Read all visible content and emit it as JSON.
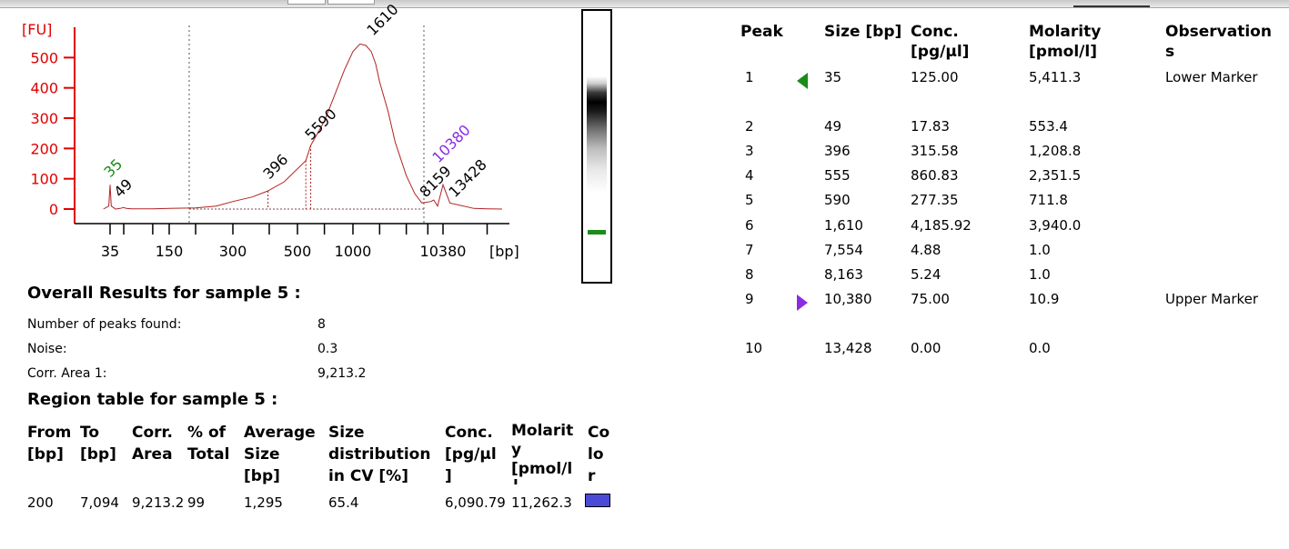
{
  "electropherogram": {
    "fu_label": "[FU]",
    "bp_label": "[bp]",
    "y_ticks": [
      "500",
      "400",
      "300",
      "200",
      "100",
      "0"
    ],
    "x_ticks": [
      "35",
      "150",
      "300",
      "500",
      "1000",
      "10380"
    ],
    "peak_labels": {
      "p35": "35",
      "p49": "49",
      "p396": "396",
      "p5590": "5590",
      "p1610": "1610",
      "p10380": "10380",
      "p13428": "13428",
      "p8159": "8159"
    },
    "colors": {
      "axis": "#e00000",
      "trace": "#b22222",
      "lower_marker": "#1a8c1a",
      "upper_marker": "#8a2be2",
      "grid_dotted": "#555555"
    }
  },
  "chart_data": {
    "type": "line",
    "title": "",
    "xlabel": "[bp]",
    "ylabel": "[FU]",
    "ylim": [
      0,
      550
    ],
    "x_scale": "log",
    "x_ticks": [
      35,
      150,
      300,
      500,
      1000,
      10380
    ],
    "series": [
      {
        "x": [
          30,
          34,
          35,
          36,
          40,
          45,
          49,
          52,
          60,
          100,
          150,
          200,
          250,
          300,
          350,
          396,
          450,
          555,
          590,
          700,
          800,
          900,
          1000,
          1200,
          1400,
          1610,
          1800,
          2000,
          2500,
          3000,
          4000,
          5000,
          6000,
          7554,
          8163,
          9000,
          10380,
          11000,
          13428,
          15000,
          17000
        ],
        "y": [
          0,
          10,
          80,
          10,
          0,
          2,
          5,
          2,
          1,
          1,
          2,
          4,
          10,
          25,
          40,
          60,
          90,
          160,
          210,
          290,
          380,
          460,
          520,
          545,
          540,
          520,
          480,
          420,
          320,
          220,
          110,
          50,
          20,
          25,
          30,
          10,
          80,
          20,
          2,
          1,
          0
        ]
      }
    ],
    "peaks_marked": [
      35,
      49,
      396,
      555,
      590,
      1610,
      7554,
      8163,
      10380,
      13428
    ]
  },
  "gel": {
    "marker_top_color": "#8a2be2",
    "marker_bottom_color": "#1a8c1a"
  },
  "overall": {
    "title": "Overall Results for sample 5  :",
    "rows": [
      {
        "label": "Number of peaks found:",
        "value": "8"
      },
      {
        "label": "Noise:",
        "value": "0.3"
      },
      {
        "label": "Corr. Area 1:",
        "value": "9,213.2"
      }
    ]
  },
  "region": {
    "title": "Region table for sample 5  :",
    "headers": [
      [
        "From",
        "[bp]"
      ],
      [
        "To",
        "[bp]"
      ],
      [
        "Corr.",
        "Area"
      ],
      [
        "% of",
        "Total"
      ],
      [
        "Average",
        "Size",
        "[bp]"
      ],
      [
        "Size",
        "distribution",
        "in CV [%]"
      ],
      [
        "Conc.",
        "[pg/µl",
        "]"
      ],
      [
        "Molarit",
        "y",
        "[pmol/l",
        "]"
      ],
      [
        "Co",
        "lo",
        "r"
      ]
    ],
    "row": [
      "200",
      "7,094",
      "9,213.2",
      "99",
      "1,295",
      "65.4",
      "6,090.79",
      "11,262.3"
    ],
    "swatch_color": "#4a4ad6"
  },
  "peaks": {
    "headers": {
      "peak": "Peak",
      "size": "Size [bp]",
      "conc": [
        "Conc.",
        "[pg/µl]"
      ],
      "molarity": [
        "Molarity",
        "[pmol/l]"
      ],
      "obs": [
        "Observation",
        "s"
      ]
    },
    "rows": [
      {
        "peak": "1",
        "marker": "lower",
        "size": "35",
        "conc": "125.00",
        "mol": "5,411.3",
        "obs": "Lower Marker"
      },
      {
        "peak": "2",
        "marker": "",
        "size": "49",
        "conc": "17.83",
        "mol": "553.4",
        "obs": ""
      },
      {
        "peak": "3",
        "marker": "",
        "size": "396",
        "conc": "315.58",
        "mol": "1,208.8",
        "obs": ""
      },
      {
        "peak": "4",
        "marker": "",
        "size": "555",
        "conc": "860.83",
        "mol": "2,351.5",
        "obs": ""
      },
      {
        "peak": "5",
        "marker": "",
        "size": "590",
        "conc": "277.35",
        "mol": "711.8",
        "obs": ""
      },
      {
        "peak": "6",
        "marker": "",
        "size": "1,610",
        "conc": "4,185.92",
        "mol": "3,940.0",
        "obs": ""
      },
      {
        "peak": "7",
        "marker": "",
        "size": "7,554",
        "conc": "4.88",
        "mol": "1.0",
        "obs": ""
      },
      {
        "peak": "8",
        "marker": "",
        "size": "8,163",
        "conc": "5.24",
        "mol": "1.0",
        "obs": ""
      },
      {
        "peak": "9",
        "marker": "upper",
        "size": "10,380",
        "conc": "75.00",
        "mol": "10.9",
        "obs": "Upper Marker"
      },
      {
        "peak": "10",
        "marker": "",
        "size": "13,428",
        "conc": "0.00",
        "mol": "0.0",
        "obs": ""
      }
    ]
  }
}
